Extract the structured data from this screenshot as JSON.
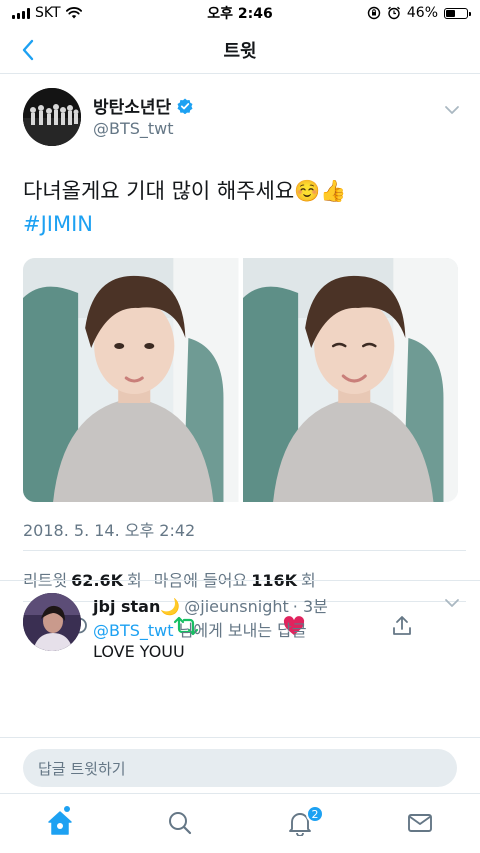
{
  "status_bar": {
    "carrier": "SKT",
    "time": "오후 2:46",
    "battery": "46%",
    "battery_level": 0.46
  },
  "nav": {
    "title": "트윗"
  },
  "tweet": {
    "author_name": "방탄소년단",
    "author_handle": "@BTS_twt",
    "text": "다녀올게요 기대 많이 해주세요☺️👍",
    "hashtag": "#JIMIN",
    "timestamp": "2018. 5. 14. 오후 2:42",
    "stats": {
      "retweets_label": "리트윗",
      "retweets_count": "62.6K",
      "retweets_unit": "회",
      "likes_label": "마음에 들어요",
      "likes_count": "116K",
      "likes_unit": "회"
    }
  },
  "reply": {
    "name": "jbj stan🌙",
    "handle": "@jieunsnight",
    "time": "· 3분",
    "mention": "@BTS_twt",
    "reply_to_suffix": "님에게 보내는 답글",
    "text": "LOVE YOUU"
  },
  "compose": {
    "placeholder": "답글 트윗하기"
  },
  "tab_bar": {
    "notifications_badge": "2"
  },
  "colors": {
    "twitter_blue": "#1da1f2",
    "retweet_green": "#17bf63",
    "like_red": "#e0245e",
    "secondary_text": "#657786"
  },
  "icons": [
    "back-chevron-icon",
    "verified-badge-icon",
    "chevron-down-icon",
    "reply-icon",
    "retweet-icon",
    "heart-icon",
    "share-icon",
    "home-icon",
    "search-icon",
    "notifications-bell-icon",
    "messages-icon",
    "wifi-icon",
    "signal-icon",
    "alarm-icon",
    "lock-rotation-icon"
  ]
}
